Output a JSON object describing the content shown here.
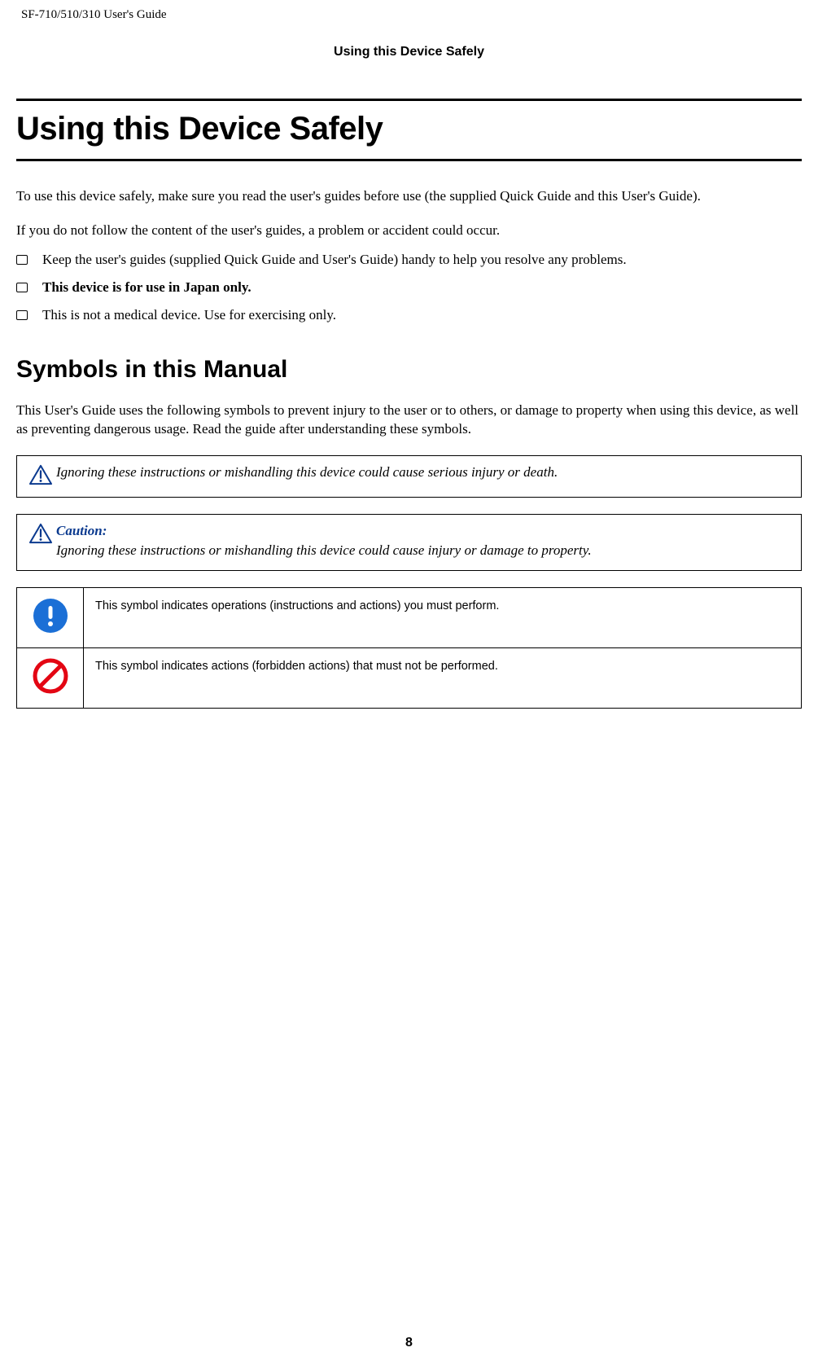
{
  "header": {
    "doc_id": "SF-710/510/310     User's Guide"
  },
  "section_header": "Using this Device Safely",
  "title": "Using this Device Safely",
  "intro1": "To use this device safely, make sure you read the user's guides before use (the supplied Quick Guide and this User's Guide).",
  "intro2": "If you do not follow the content of the user's guides, a problem or accident could occur.",
  "bullets": {
    "b1": "Keep the user's guides (supplied Quick Guide and User's Guide) handy to help you resolve any problems.",
    "b2": "This device is for use in Japan only.",
    "b3": "This is not a medical device. Use for exercising only."
  },
  "sub_heading": "Symbols in this Manual",
  "sub_intro": "This User's Guide uses the following symbols to prevent injury to the user or to others, or damage to property when using this device, as well as preventing dangerous usage. Read the guide after understanding these symbols.",
  "callout1": {
    "text": "Ignoring these instructions or mishandling this device could cause serious injury or death."
  },
  "callout2": {
    "label": "Caution:",
    "text": "Ignoring these instructions or mishandling this device could cause injury or damage to property."
  },
  "table": {
    "row1": "This symbol indicates operations (instructions and actions) you must perform.",
    "row2": "This symbol indicates actions (forbidden actions) that must not be performed."
  },
  "page_number": "8"
}
